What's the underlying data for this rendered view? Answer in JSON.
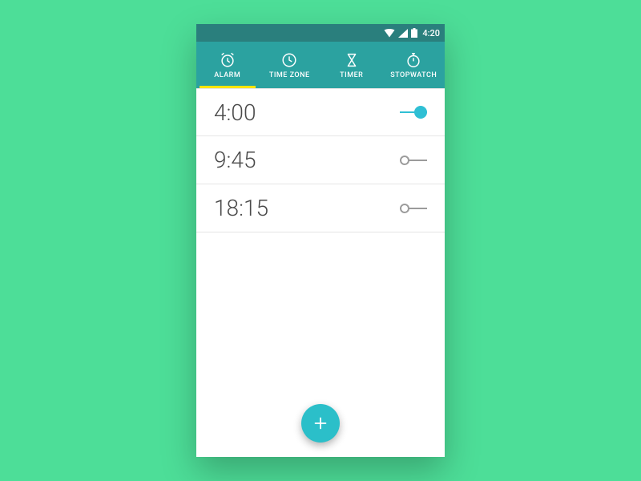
{
  "statusbar": {
    "time": "4:20"
  },
  "tabs": [
    {
      "label": "ALARM",
      "active": true
    },
    {
      "label": "TIME ZONE",
      "active": false
    },
    {
      "label": "TIMER",
      "active": false
    },
    {
      "label": "STOPWATCH",
      "active": false
    }
  ],
  "alarms": [
    {
      "time": "4:00",
      "enabled": true
    },
    {
      "time": "9:45",
      "enabled": false
    },
    {
      "time": "18:15",
      "enabled": false
    }
  ],
  "colors": {
    "background": "#4dde98",
    "statusbar": "#2a7f7d",
    "tabbar": "#2ba2a0",
    "accent": "#2fbfd4",
    "indicator": "#ffe600",
    "fab": "#2bbfc9"
  }
}
